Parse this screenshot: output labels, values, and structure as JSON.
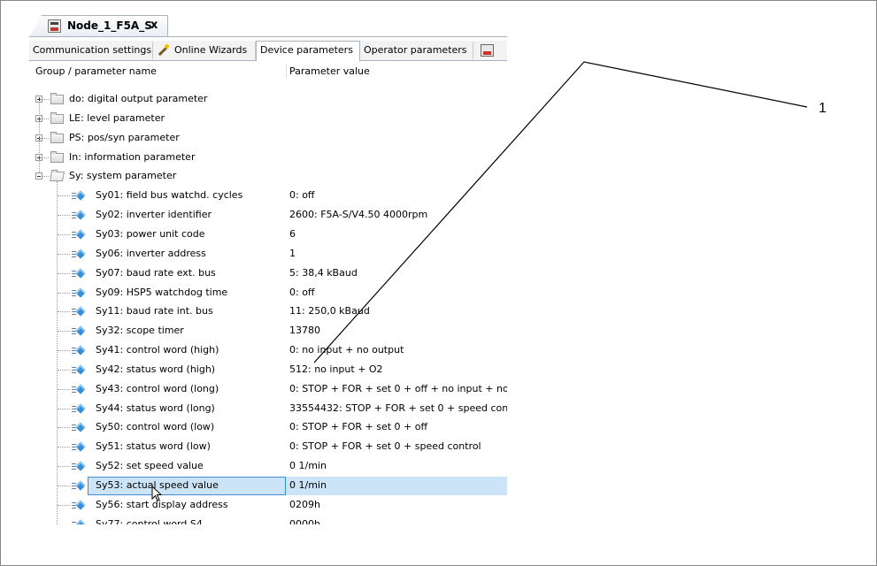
{
  "document_tab": {
    "title": "Node_1_F5A_S",
    "close": "x",
    "icon": "keb-device-icon"
  },
  "param_tabs": [
    {
      "label": "Communication settings"
    },
    {
      "label": "Online Wizards",
      "icon": "wand-icon"
    },
    {
      "label": "Device parameters",
      "active": true
    },
    {
      "label": "Operator parameters"
    },
    {
      "label": "",
      "icon": "keb-device-icon"
    }
  ],
  "columns": {
    "name": "Group / parameter name",
    "value": "Parameter value"
  },
  "groups": [
    {
      "label": "do: digital output parameter",
      "expanded": false
    },
    {
      "label": "LE: level parameter",
      "expanded": false
    },
    {
      "label": "PS: pos/syn parameter",
      "expanded": false
    },
    {
      "label": "In: information parameter",
      "expanded": false
    },
    {
      "label": "Sy: system parameter",
      "expanded": true
    }
  ],
  "parameters": [
    {
      "name": "Sy01: field bus watchd. cycles",
      "value": "0: off"
    },
    {
      "name": "Sy02: inverter identifier",
      "value": "2600: F5A-S/V4.50 4000rpm"
    },
    {
      "name": "Sy03: power unit code",
      "value": "6"
    },
    {
      "name": "Sy06: inverter address",
      "value": "1"
    },
    {
      "name": "Sy07: baud rate ext. bus",
      "value": "5: 38,4 kBaud"
    },
    {
      "name": "Sy09: HSP5 watchdog time",
      "value": "0: off"
    },
    {
      "name": "Sy11: baud rate int. bus",
      "value": "11: 250,0 kBaud"
    },
    {
      "name": "Sy32: scope timer",
      "value": "13780"
    },
    {
      "name": "Sy41: control word (high)",
      "value": "0: no input + no output"
    },
    {
      "name": "Sy42: status word (high)",
      "value": "512: no input + O2"
    },
    {
      "name": "Sy43: control word (long)",
      "value": "0: STOP + FOR + set 0 + off + no input + no"
    },
    {
      "name": "Sy44: status word (long)",
      "value": "33554432: STOP + FOR + set 0 + speed con"
    },
    {
      "name": "Sy50: control word (low)",
      "value": "0: STOP + FOR + set 0 + off"
    },
    {
      "name": "Sy51: status word (low)",
      "value": "0: STOP + FOR + set 0 + speed control"
    },
    {
      "name": "Sy52: set speed value",
      "value": "0 1/min"
    },
    {
      "name": "Sy53: actual speed value",
      "value": "0 1/min",
      "selected": true
    },
    {
      "name": "Sy56: start display address",
      "value": "0209h"
    },
    {
      "name": "Sy77: control word S4",
      "value": "0000h"
    }
  ],
  "callout": {
    "label": "1"
  },
  "colors": {
    "selection": "#cce4f7",
    "selection_border": "#3e8cd6",
    "param_icon": "#3a8fd4"
  }
}
